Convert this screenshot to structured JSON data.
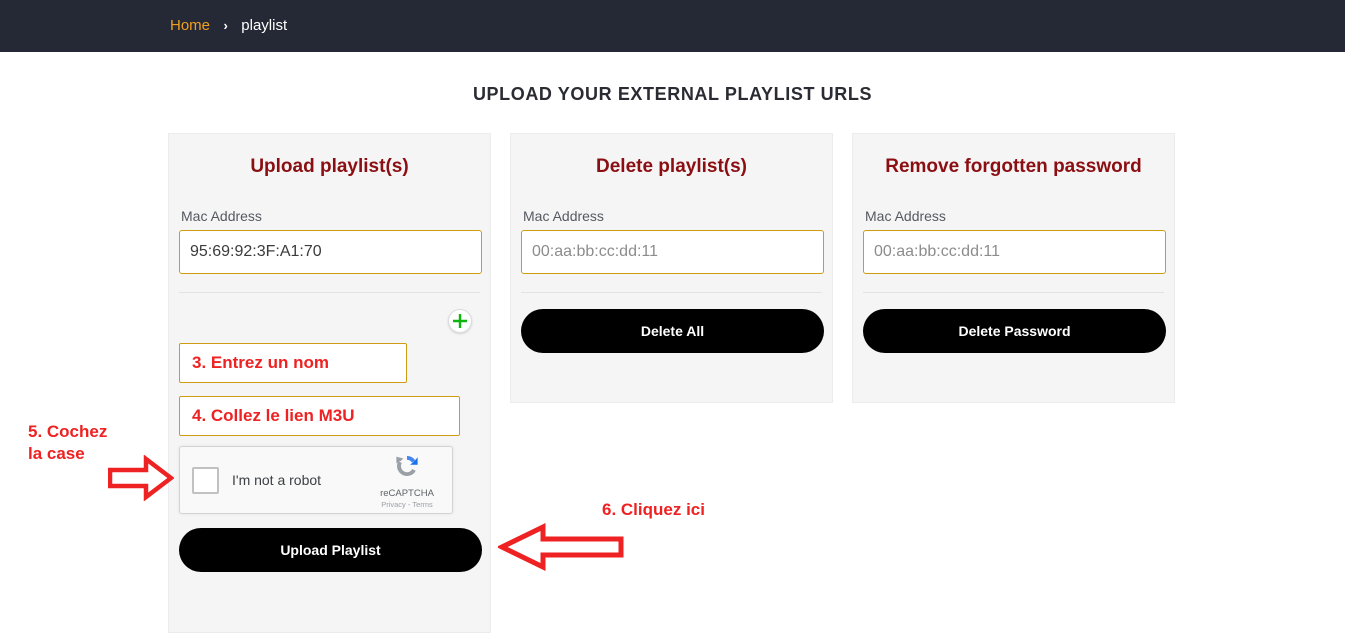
{
  "breadcrumb": {
    "home_label": "Home",
    "separator": "›",
    "current_label": "playlist"
  },
  "page_title": "UPLOAD YOUR EXTERNAL PLAYLIST URLS",
  "cards": {
    "upload": {
      "title": "Upload playlist(s)",
      "mac_label": "Mac Address",
      "mac_value": "95:69:92:3F:A1:70",
      "mac_placeholder": "00:aa:bb:cc:dd:11",
      "add_icon": "plus-icon",
      "name_annotation": "3. Entrez un nom",
      "m3u_annotation": "4. Collez le lien M3U",
      "submit_label": "Upload Playlist"
    },
    "delete": {
      "title": "Delete playlist(s)",
      "mac_label": "Mac Address",
      "mac_value": "",
      "mac_placeholder": "00:aa:bb:cc:dd:11",
      "submit_label": "Delete All"
    },
    "password": {
      "title": "Remove forgotten password",
      "mac_label": "Mac Address",
      "mac_value": "",
      "mac_placeholder": "00:aa:bb:cc:dd:11",
      "submit_label": "Delete Password"
    }
  },
  "recaptcha": {
    "label": "I'm not a robot",
    "brand": "reCAPTCHA",
    "legal": "Privacy - Terms"
  },
  "annotations": {
    "step5": "5. Cochez\nla case",
    "step5_line1": "5. Cochez",
    "step5_line2": "la case",
    "step6": "6. Cliquez ici",
    "arrow_right_icon": "arrow-right-icon",
    "arrow_left_icon": "arrow-left-icon"
  },
  "colors": {
    "header_bg": "#252835",
    "breadcrumb_link": "#f0a020",
    "card_bg": "#f5f5f6",
    "card_title": "#8b0f12",
    "input_border": "#cf9d13",
    "button_bg": "#000000",
    "annotation_red": "#ee2222",
    "plus_green": "#0db50d"
  }
}
